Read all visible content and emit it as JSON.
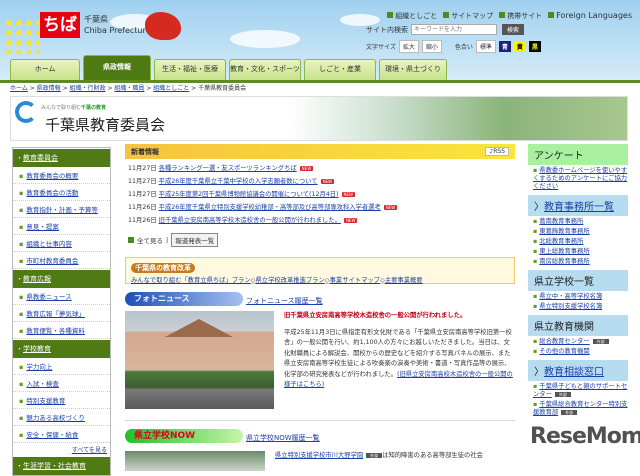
{
  "header": {
    "logo": "ちば",
    "pref_ja": "千葉県",
    "pref_en": "Chiba Prefecture",
    "top_links": [
      "組織としごと",
      "サイトマップ",
      "携帯サイト",
      "Foreign Languages"
    ],
    "search_label": "サイト内検索",
    "search_placeholder": "キーワードを入力",
    "search_button": "検索",
    "font_size_label": "文字サイズ",
    "enlarge": "拡大",
    "shrink": "縮小",
    "color_label": "色合い",
    "color_std": "標準",
    "color_blue": "青",
    "color_yellow": "黄",
    "color_black": "黒"
  },
  "tabs": [
    "ホーム",
    "県政情報",
    "生活・福祉・医療",
    "教育・文化・スポーツ",
    "しごと・産業",
    "環境・県土づくり"
  ],
  "breadcrumb": [
    "ホーム",
    "県政情報",
    "組織・行財政",
    "組織・職員",
    "組織としごと",
    "千葉県教育委員会"
  ],
  "banner": {
    "tagline": "みんなで取り組む",
    "tagline_bold": "千葉の教育",
    "title": "千葉県教育委員会"
  },
  "left": {
    "sections": [
      {
        "title": "教育委員会",
        "items": [
          "教育委員会の概要",
          "教育委員会の活動",
          "教育指針・計画・予算等",
          "意見・提案",
          "組織と仕事内容",
          "市町村教育委員会"
        ]
      },
      {
        "title": "教育広報",
        "items": [
          "県教委ニュース",
          "教育広報「夢気球」",
          "教育便覧・各種資料"
        ]
      },
      {
        "title": "学校教育",
        "items": [
          "学力向上",
          "入試・検査",
          "特別支援教育",
          "魅力ある高校づくり",
          "安全・保健・給食"
        ],
        "more": "すべてを見る"
      },
      {
        "title": "生涯学習・社会教育",
        "items": []
      }
    ]
  },
  "news": {
    "title": "新着情報",
    "rss": "RSS",
    "new_badge": "NEW",
    "items": [
      {
        "date": "11月27日",
        "text": "各種ランキング一選・友スポーツランキングちば"
      },
      {
        "date": "11月27日",
        "text": "平成26年度千葉県立千葉中学校の入学志願者数について"
      },
      {
        "date": "11月27日",
        "text": "平成25年度第2回千葉県博物館協議会の開催について(12月4日)"
      },
      {
        "date": "11月26日",
        "text": "平成26年度千葉県立特別支援学校幼稚部・高等部及び高等部専攻科入学者選考"
      },
      {
        "date": "11月26日",
        "text": "旧千葉県立安房南高等学校木造校舎の一般公開が行われました。"
      }
    ],
    "all": "全て見る",
    "press": "報道発表一覧"
  },
  "reform": {
    "title": "千葉県の教育改革",
    "links": [
      "みんなで取り組む「教育立県ちば」プラン",
      "県立学校改革推進プラン",
      "事業サイトマップ",
      "主要事業概要"
    ]
  },
  "photo_news": {
    "title": "フォトニュース",
    "archive": "フォトニュース履歴一覧",
    "headline": "旧千葉県立安房南高等学校木造校舎の一般公開が行われました。",
    "body": "平成25年11月3日に県指定有形文化財である「千葉県立安房南高等学校旧第一校舎」の一般公開を行い、約1,100人の方々にお越しいただきました。当日は、文化財職員による解説会、開校からの歴史などを紹介する写真パネルの展示、また県立安房南高等学校生徒による吹奏楽の演奏や美術・書道・写真作品等の展示、化学部の研究発表などが行われました。",
    "link": "(旧県立安房南高校木造校舎の一般公開の様子はこちら)"
  },
  "school_now": {
    "title": "県立学校NOW",
    "archive": "県立学校NOW履歴一覧",
    "link": "県立特別支援学校市川大野学園",
    "ext": "外部",
    "text": "は知的障害のある高等部生徒の社会"
  },
  "right": {
    "sections": [
      {
        "title": "アンケート",
        "style": "green",
        "items": [
          "県教委ホームページを使いやすくするためのアンケートにご協力ください"
        ]
      },
      {
        "title": "教育事務所一覧",
        "style": "blue",
        "arrow": true,
        "items": [
          "葛南教育事務所",
          "東葛飾教育事務所",
          "北総教育事務所",
          "東上総教育事務所",
          "南房総教育事務所"
        ]
      },
      {
        "title": "県立学校一覧",
        "style": "blue",
        "items": [
          "県立中・高等学校名簿",
          "県立特別支援学校名簿"
        ]
      },
      {
        "title": "県立教育機関",
        "style": "blue",
        "items": [
          "総合教育センター",
          "その他の教育機関"
        ],
        "ext": [
          true,
          false
        ]
      },
      {
        "title": "教育相談窓口",
        "style": "blue",
        "arrow": true,
        "items": [
          "千葉県子どもと親のサポートセンター",
          "千葉県総合教育センター特別支援教育部"
        ],
        "ext": [
          true,
          true
        ]
      }
    ],
    "ext_label": "外部"
  },
  "watermark": "ReseMom"
}
